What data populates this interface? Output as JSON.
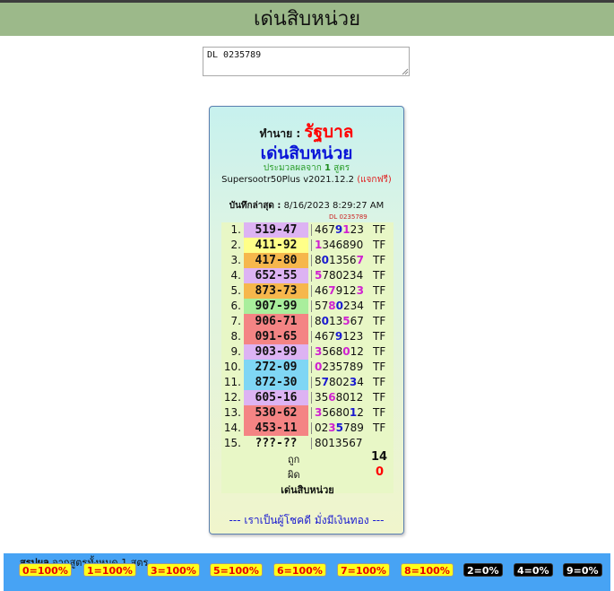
{
  "header": {
    "title": "เด่นสิบหน่วย"
  },
  "input": {
    "value": "DL 0235789"
  },
  "card": {
    "predict_prefix": "ทำนาย :",
    "lottery_name": "รัฐบาล",
    "subtitle": "เด่นสิบหน่วย",
    "process_text": "ประมวลผลจาก",
    "formula_count": "1",
    "formula_unit": "สูตร",
    "version": "Supersootr50Plus v2021.12.2",
    "free_text": "(แจกฟรี)",
    "last_saved_label": "บันทึกล่าสุด :",
    "last_saved_value": "8/16/2023 8:29:27 AM",
    "dl_small": "DL 0235789",
    "rows": [
      {
        "n": "1.",
        "pair": "519-47",
        "pair_bg": "#ddb3f3",
        "digits": "4679123",
        "hl": [
          3,
          4
        ],
        "res": "TF"
      },
      {
        "n": "2.",
        "pair": "411-92",
        "pair_bg": "#ffff88",
        "digits": "1346890",
        "hl": [
          0
        ],
        "res": "TF"
      },
      {
        "n": "3.",
        "pair": "417-80",
        "pair_bg": "#f6b74c",
        "digits": "8013567",
        "hl": [
          1,
          6
        ],
        "res": "TF"
      },
      {
        "n": "4.",
        "pair": "652-55",
        "pair_bg": "#ddb3f3",
        "digits": "5780234",
        "hl": [
          0
        ],
        "res": "TF"
      },
      {
        "n": "5.",
        "pair": "873-73",
        "pair_bg": "#f6b74c",
        "digits": "4679123",
        "hl": [
          2,
          6
        ],
        "res": "TF"
      },
      {
        "n": "6.",
        "pair": "907-99",
        "pair_bg": "#a9ee9c",
        "digits": "5780234",
        "hl": [
          2,
          3
        ],
        "res": "TF"
      },
      {
        "n": "7.",
        "pair": "906-71",
        "pair_bg": "#f48484",
        "digits": "8013567",
        "hl": [
          1,
          4
        ],
        "res": "TF"
      },
      {
        "n": "8.",
        "pair": "091-65",
        "pair_bg": "#f48484",
        "digits": "4679123",
        "hl": [
          3
        ],
        "res": "TF"
      },
      {
        "n": "9.",
        "pair": "903-99",
        "pair_bg": "#ddb3f3",
        "digits": "3568012",
        "hl": [
          0,
          4
        ],
        "res": "TF"
      },
      {
        "n": "10.",
        "pair": "272-09",
        "pair_bg": "#7fd6f4",
        "digits": "0235789",
        "hl": [
          0
        ],
        "res": "TF"
      },
      {
        "n": "11.",
        "pair": "872-30",
        "pair_bg": "#7fd6f4",
        "digits": "5780234",
        "hl": [
          1,
          5
        ],
        "res": "TF"
      },
      {
        "n": "12.",
        "pair": "605-16",
        "pair_bg": "#ddb3f3",
        "digits": "3568012",
        "hl": [
          2
        ],
        "res": "TF"
      },
      {
        "n": "13.",
        "pair": "530-62",
        "pair_bg": "#f48484",
        "digits": "3568012",
        "hl": [
          0,
          5
        ],
        "res": "TF"
      },
      {
        "n": "14.",
        "pair": "453-11",
        "pair_bg": "#f48484",
        "digits": "0235789",
        "hl": [
          2,
          3
        ],
        "res": "TF"
      },
      {
        "n": "15.",
        "pair": "???-??",
        "pair_bg": "#e8f7c6",
        "digits": "8013567",
        "hl": [],
        "res": ""
      }
    ],
    "correct_label": "ถูก",
    "correct_value": "14",
    "wrong_label": "ผิด",
    "wrong_value": "0",
    "table_footer": "เด่นสิบหน่วย",
    "slogan": "--- เราเป็นผู้โชคดี มั่งมีเงินทอง ---"
  },
  "summary": {
    "label_bold": "สรุปผล",
    "label_rest": "จากสูตรทั้งหมด 1 สูตร",
    "badges": [
      {
        "text": "0=100%",
        "style": "yellow"
      },
      {
        "text": "1=100%",
        "style": "yellow"
      },
      {
        "text": "3=100%",
        "style": "yellow"
      },
      {
        "text": "5=100%",
        "style": "yellow"
      },
      {
        "text": "6=100%",
        "style": "yellow"
      },
      {
        "text": "7=100%",
        "style": "yellow"
      },
      {
        "text": "8=100%",
        "style": "yellow"
      },
      {
        "text": "2=0%",
        "style": "black"
      },
      {
        "text": "4=0%",
        "style": "black"
      },
      {
        "text": "9=0%",
        "style": "black"
      }
    ]
  },
  "colors": {
    "header_bg": "#9cb98a",
    "digit_highlight_a": "#1a1ad0",
    "digit_highlight_b": "#d020d0",
    "badge_yellow": "#ffff1a",
    "bar_blue": "#47a3f4"
  }
}
